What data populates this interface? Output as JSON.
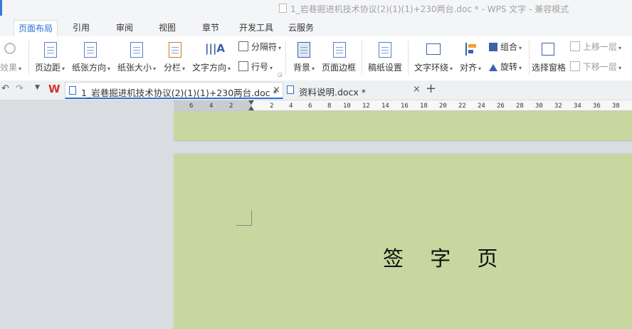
{
  "window": {
    "title": "1_岩巷掘进机技术协议(2)(1)(1)+230两台.doc * - WPS 文字 - 兼容模式"
  },
  "menu": {
    "tabs": [
      "页面布局",
      "引用",
      "审阅",
      "视图",
      "章节",
      "开发工具",
      "云服务"
    ],
    "active_tab": "页面布局"
  },
  "ribbon": {
    "effect": "效果",
    "margins": "页边距",
    "orientation": "纸张方向",
    "size": "纸张大小",
    "columns": "分栏",
    "text_direction": "文字方向",
    "breaks": "分隔符",
    "line_numbers": "行号",
    "background": "背景",
    "page_border": "页面边框",
    "draft_paper": "稿纸设置",
    "text_wrap": "文字环绕",
    "align": "对齐",
    "group": "组合",
    "rotate": "旋转",
    "selection_pane": "选择窗格",
    "bring_forward": "上移一层",
    "send_backward": "下移一层"
  },
  "doc_tabs": [
    {
      "label": "1_岩巷掘进机技术协议(2)(1)(1)+230两台.doc *",
      "active": true
    },
    {
      "label": "资料说明.docx *",
      "active": false
    }
  ],
  "ruler": {
    "ticks": [
      "6",
      "4",
      "2",
      "2",
      "4",
      "6",
      "8",
      "10",
      "12",
      "14",
      "16",
      "18",
      "20",
      "22",
      "24",
      "26",
      "28",
      "30",
      "32",
      "34",
      "36",
      "38"
    ]
  },
  "document": {
    "page_title": "签 字 页"
  },
  "colors": {
    "accent": "#2b6fd1",
    "page_background": "#c6d89f",
    "workspace": "#d9dce1"
  }
}
